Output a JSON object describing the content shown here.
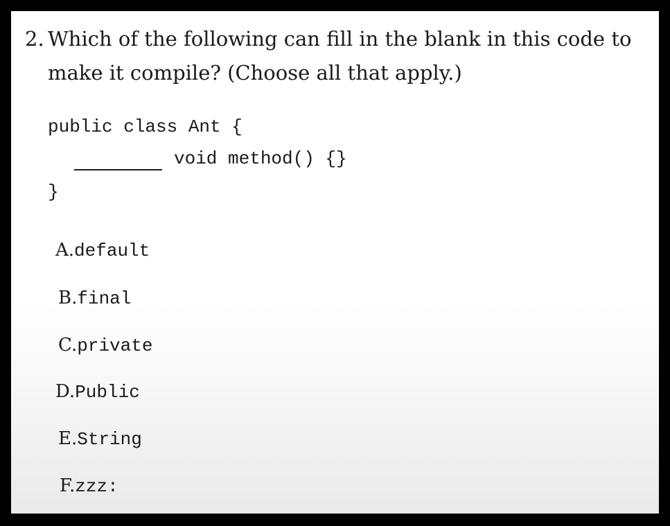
{
  "question": {
    "number": "2.",
    "line1": "Which of the following can fill in the blank in this code to",
    "line2": "make it compile? (Choose all that apply.)"
  },
  "code": {
    "line1": "public class Ant {",
    "line2": "void method() {}",
    "line3": "}"
  },
  "options": [
    {
      "letter": "A.",
      "text": "default"
    },
    {
      "letter": "B.",
      "text": "final"
    },
    {
      "letter": "C.",
      "text": "private"
    },
    {
      "letter": "D.",
      "text": "Public"
    },
    {
      "letter": "E.",
      "text": "String"
    },
    {
      "letter": "F.",
      "text": "zzz:"
    }
  ]
}
